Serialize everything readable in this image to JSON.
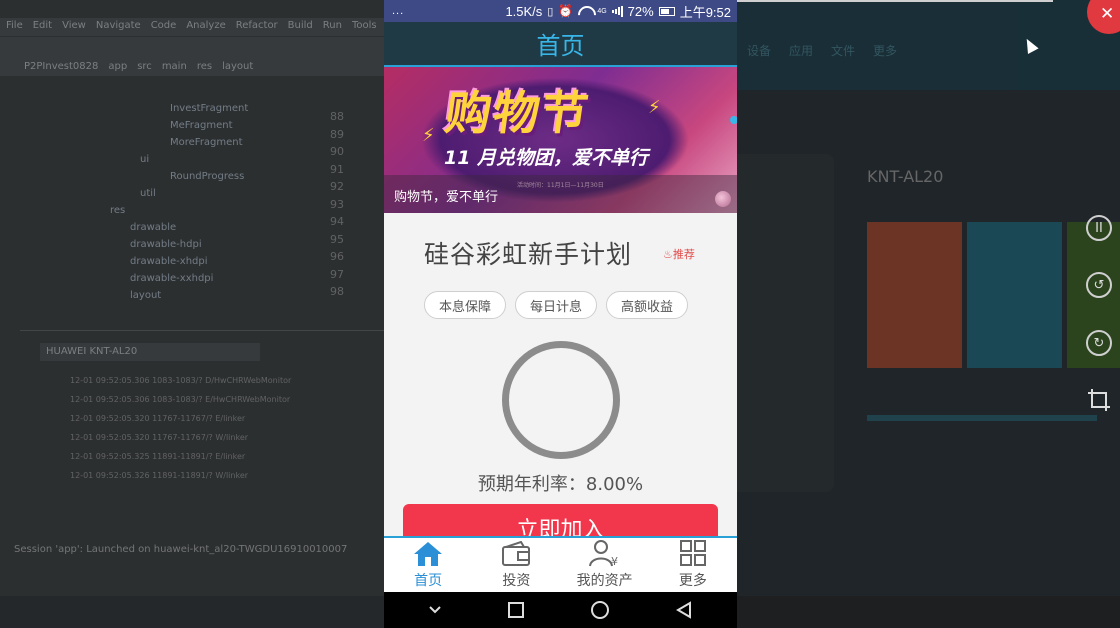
{
  "phone": {
    "statusbar": {
      "dots": "...",
      "net_speed": "1.5K/s",
      "network_type": "4G",
      "battery": "72%",
      "battery_level": 0.72,
      "time": "上午9:52"
    },
    "header": {
      "title": "首页"
    },
    "banner": {
      "headline": "购物节",
      "subline": "11 月兑物团，爱不单行",
      "fine_print": "活动时间：11月1日—11月30日",
      "caption": "购物节，爱不单行"
    },
    "product": {
      "title": "硅谷彩虹新手计划",
      "tag": "推荐",
      "chips": [
        "本息保障",
        "每日计息",
        "高额收益"
      ],
      "rate": "预期年利率：8.00%",
      "join_button": "立即加入"
    },
    "tabs": [
      {
        "label": "首页",
        "icon": "home-icon",
        "active": true
      },
      {
        "label": "投资",
        "icon": "wallet-icon",
        "active": false
      },
      {
        "label": "我的资产",
        "icon": "user-money-icon",
        "active": false
      },
      {
        "label": "更多",
        "icon": "grid-icon",
        "active": false
      }
    ],
    "navbar": [
      "chevron-down-icon",
      "square-icon",
      "circle-icon",
      "triangle-back-icon"
    ]
  },
  "colors": {
    "statusbar": "#3e4a86",
    "header_bg": "#1f3a45",
    "header_text": "#38b6e8",
    "accent_blue": "#2a8fd6",
    "join_button": "#f2374c",
    "tag_red": "#e24a4a"
  }
}
